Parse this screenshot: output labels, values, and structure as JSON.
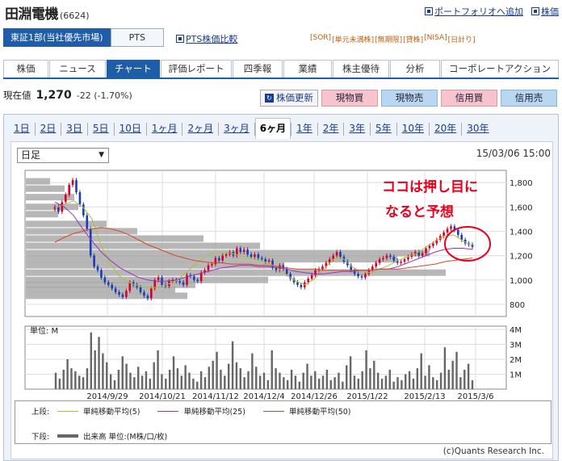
{
  "company": {
    "name": "田淵電機",
    "code": "(6624)"
  },
  "toplinks": [
    "ポートフォリオへ追加",
    "株価"
  ],
  "market": {
    "primary": "東証1部(当社優先市場)",
    "pts": "PTS",
    "pts_compare": "PTS株価比較"
  },
  "badges": [
    "[SOR]",
    "[単元未満株]",
    "[無期限]",
    "[貸株]",
    "[NISA]",
    "[日計り]"
  ],
  "main_tabs": [
    "株価",
    "ニュース",
    "チャート",
    "評価レポート",
    "四季報",
    "業績",
    "株主優待",
    "分析",
    "コーポレートアクション"
  ],
  "main_tab_active": 2,
  "price": {
    "label": "現在値",
    "value": "1,270",
    "change": "-22 (-1.70%)"
  },
  "actions": {
    "update": "株価更新",
    "spot_buy": "現物買",
    "spot_sell": "現物売",
    "margin_buy": "信用買",
    "margin_sell": "信用売"
  },
  "periods": [
    "1日",
    "2日",
    "3日",
    "5日",
    "10日",
    "1ヶ月",
    "2ヶ月",
    "3ヶ月",
    "6ヶ月",
    "1年",
    "2年",
    "3年",
    "5年",
    "10年",
    "20年",
    "30年"
  ],
  "period_active": 8,
  "chart_select": "日足",
  "timestamp": "15/03/06 15:00",
  "annotation": {
    "line1": "ココは押し目に",
    "line2": "なると予想"
  },
  "colors": {
    "accent": "#1f5da8",
    "up": "#d6002a",
    "down": "#1a3cb4",
    "ma5": "#a9c33a",
    "ma25": "#9b2fc4",
    "ma50": "#d24a2a"
  },
  "chart_data": [
    {
      "type": "line",
      "y_ticks": [
        "1,800",
        "1,600",
        "1,400",
        "1,200",
        "1,000",
        "800"
      ],
      "ylim": [
        700,
        1900
      ],
      "x_labels": [
        "2014/9/29",
        "2014/10/21",
        "2014/11/12",
        "2014/12/4",
        "2014/12/26",
        "2015/1/22",
        "2015/2/13",
        "2015/3/6"
      ],
      "series": [
        {
          "name": "単純移動平均(5)",
          "values": [
            1590,
            1620,
            1650,
            1600,
            1500,
            1280,
            1130,
            1030,
            980,
            950,
            935,
            940,
            960,
            990,
            1050,
            1120,
            1180,
            1220,
            1230,
            1220,
            1200,
            1180,
            1160,
            1140,
            1100,
            1040,
            990,
            960,
            1010,
            1090,
            1170,
            1180,
            1110,
            1070,
            1060,
            1090,
            1120,
            1160,
            1190,
            1220,
            1270,
            1320,
            1360,
            1370,
            1320,
            1280
          ]
        },
        {
          "name": "単純移動平均(25)",
          "values": [
            1640,
            1600,
            1530,
            1420,
            1320,
            1230,
            1160,
            1100,
            1060,
            1020,
            1000,
            990,
            990,
            1000,
            1020,
            1040,
            1060,
            1080,
            1100,
            1110,
            1120,
            1120,
            1110,
            1110,
            1100,
            1090,
            1070,
            1060,
            1050,
            1050,
            1060,
            1070,
            1070,
            1080,
            1080,
            1090,
            1090,
            1110,
            1140,
            1170,
            1200,
            1230,
            1250,
            1260,
            1260,
            1250
          ]
        },
        {
          "name": "単純移動平均(50)",
          "values": [
            1310,
            1350,
            1380,
            1400,
            1420,
            1430,
            1420,
            1400,
            1370,
            1330,
            1290,
            1260,
            1230,
            1200,
            1180,
            1160,
            1150,
            1140,
            1140,
            1130,
            1130,
            1130,
            1120,
            1120,
            1110,
            1100,
            1090,
            1090,
            1090,
            1080,
            1080,
            1080,
            1080,
            1080,
            1080,
            1090,
            1090,
            1090,
            1100,
            1110,
            1120,
            1130,
            1150,
            1160,
            1170,
            1180
          ]
        }
      ]
    },
    {
      "type": "bar",
      "ylabel": "単位: M",
      "y_ticks": [
        "4M",
        "3M",
        "2M",
        "1M"
      ],
      "ylim": [
        0,
        4
      ]
    }
  ],
  "legend": {
    "upper_label": "上段:",
    "lower_label": "下段:",
    "items": [
      "単純移動平均(5)",
      "単純移動平均(25)",
      "単純移動平均(50)"
    ],
    "volume": "出来高 単位:(M株/口/枚)"
  },
  "copyright": "(c)Quants Research Inc."
}
